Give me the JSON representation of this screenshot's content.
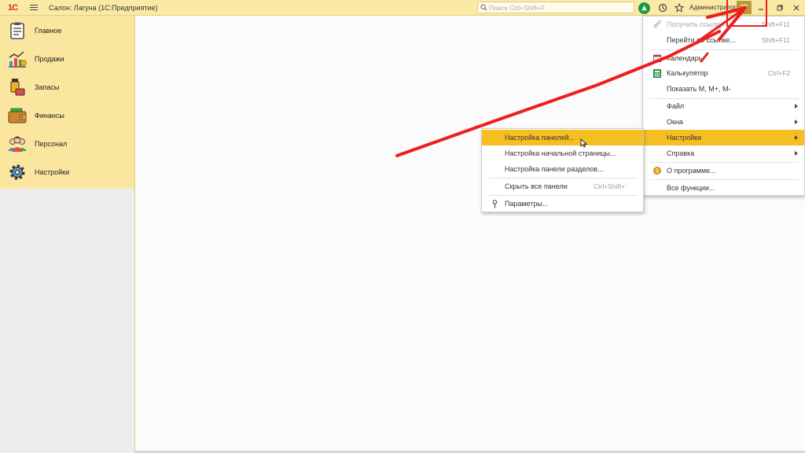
{
  "window": {
    "logo": "1С",
    "title": "Салон: Лагуна  (1С:Предприятие)",
    "search_placeholder": "Поиск Ctrl+Shift+F",
    "user": "Администратор"
  },
  "sidebar": {
    "items": [
      {
        "label": "Главное",
        "icon": "clipboard-icon"
      },
      {
        "label": "Продажи",
        "icon": "sales-chart-icon"
      },
      {
        "label": "Запасы",
        "icon": "cosmetics-icon"
      },
      {
        "label": "Финансы",
        "icon": "wallet-icon"
      },
      {
        "label": "Персонал",
        "icon": "people-icon"
      },
      {
        "label": "Настройки",
        "icon": "gear-icon"
      }
    ]
  },
  "main_menu": {
    "items": [
      {
        "label": "Получить ссылку...",
        "shortcut": "Shift+F11",
        "disabled": true
      },
      {
        "label": "Перейти по ссылке...",
        "shortcut": "Shift+F11"
      },
      {
        "label": "Календарь",
        "shortcut": ""
      },
      {
        "label": "Калькулятор",
        "shortcut": "Ctrl+F2"
      },
      {
        "label": "Показать М, М+, М-",
        "shortcut": ""
      },
      {
        "label": "Файл",
        "shortcut": ""
      },
      {
        "label": "Окна",
        "shortcut": ""
      },
      {
        "label": "Настройки",
        "shortcut": ""
      },
      {
        "label": "Справка",
        "shortcut": ""
      },
      {
        "label": "О программе...",
        "shortcut": ""
      },
      {
        "label": "Все функции...",
        "shortcut": ""
      }
    ]
  },
  "settings_submenu": {
    "items": [
      {
        "label": "Настройка панелей...",
        "shortcut": ""
      },
      {
        "label": "Настройка начальной страницы...",
        "shortcut": ""
      },
      {
        "label": "Настройка панели разделов...",
        "shortcut": ""
      },
      {
        "label": "Скрыть все панели",
        "shortcut": "Ctrl+Shift+`"
      },
      {
        "label": "Параметры...",
        "shortcut": ""
      }
    ]
  },
  "colors": {
    "accent": "#f5bf22",
    "titlebar": "#fbeaa5",
    "annotation": "#ee1e1e"
  }
}
